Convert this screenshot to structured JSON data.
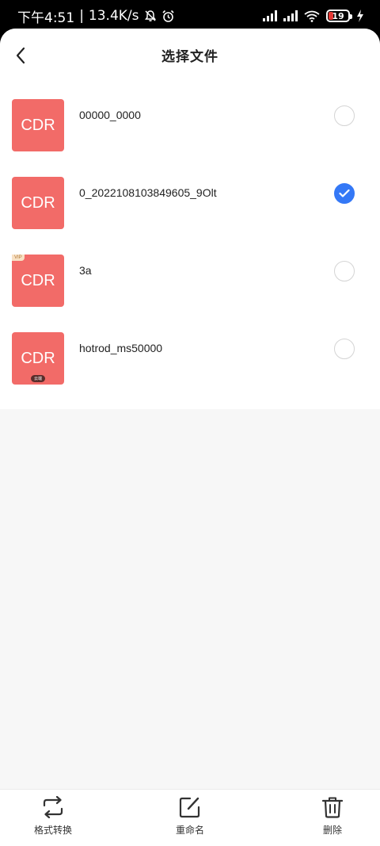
{
  "status_bar": {
    "time": "下午4:51",
    "separator": "|",
    "net_speed": "13.4K/s",
    "battery_level": "19",
    "icons": [
      "mute-bell-icon",
      "alarm-icon",
      "signal-icon",
      "signal-icon",
      "wifi-icon",
      "battery-icon",
      "charging-icon"
    ]
  },
  "nav": {
    "title": "选择文件",
    "back_icon": "chevron-left-icon"
  },
  "files": [
    {
      "name": "00000_0000",
      "thumb_label": "CDR",
      "badge": "",
      "selected": false
    },
    {
      "name": "0_2022108103849605_9Olt",
      "thumb_label": "CDR",
      "badge": "",
      "selected": true
    },
    {
      "name": "3a",
      "thumb_label": "CDR",
      "badge": "VIP",
      "selected": false
    },
    {
      "name": "hotrod_ms50000",
      "thumb_label": "CDR",
      "badge": "云端",
      "selected": false
    }
  ],
  "toolbar": {
    "convert_label": "格式转换",
    "rename_label": "重命名",
    "delete_label": "删除"
  },
  "colors": {
    "thumb": "#f26b68",
    "accent": "#3478f6",
    "background": "#f7f7f7"
  }
}
